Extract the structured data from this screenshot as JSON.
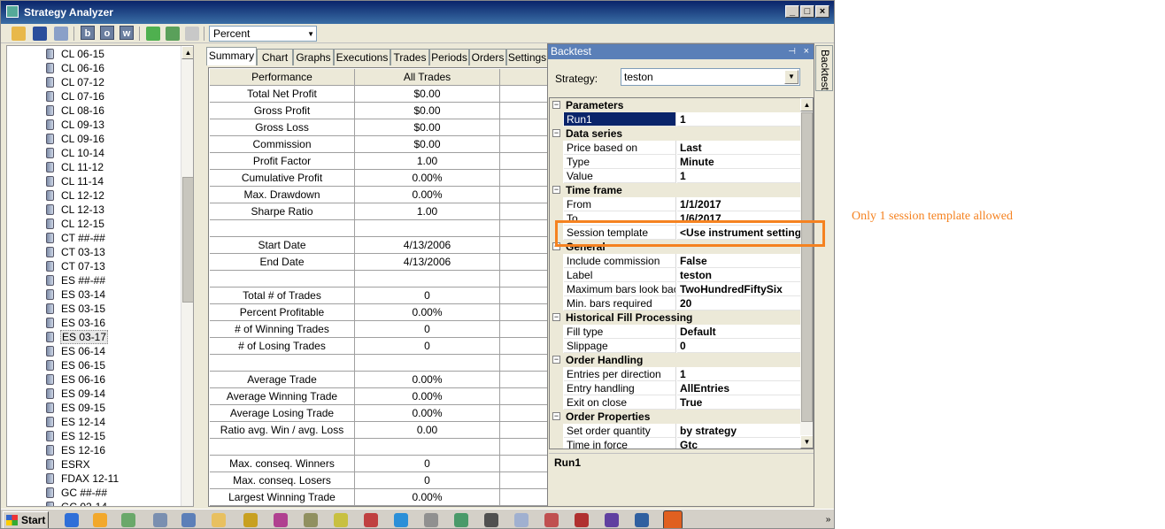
{
  "window": {
    "title": "Strategy Analyzer"
  },
  "toolbar": {
    "letter_buttons": [
      "b",
      "o",
      "w"
    ],
    "display_select": "Percent"
  },
  "instruments": [
    "CL 06-15",
    "CL 06-16",
    "CL 07-12",
    "CL 07-16",
    "CL 08-16",
    "CL 09-13",
    "CL 09-16",
    "CL 10-14",
    "CL 11-12",
    "CL 11-14",
    "CL 12-12",
    "CL 12-13",
    "CL 12-15",
    "CT ##-##",
    "CT 03-13",
    "CT 07-13",
    "ES ##-##",
    "ES 03-14",
    "ES 03-15",
    "ES 03-16",
    "ES 03-17",
    "ES 06-14",
    "ES 06-15",
    "ES 06-16",
    "ES 09-14",
    "ES 09-15",
    "ES 12-14",
    "ES 12-15",
    "ES 12-16",
    "ESRX",
    "FDAX 12-11",
    "GC ##-##",
    "GC 02-14"
  ],
  "selected_instrument": "ES 03-17",
  "tabs": [
    "Summary",
    "Chart",
    "Graphs",
    "Executions",
    "Trades",
    "Periods",
    "Orders",
    "Settings"
  ],
  "active_tab": "Summary",
  "summary": {
    "headers": [
      "Performance",
      "All Trades"
    ],
    "rows": [
      [
        "Total Net Profit",
        "$0.00"
      ],
      [
        "Gross Profit",
        "$0.00"
      ],
      [
        "Gross Loss",
        "$0.00"
      ],
      [
        "Commission",
        "$0.00"
      ],
      [
        "Profit Factor",
        "1.00"
      ],
      [
        "Cumulative Profit",
        "0.00%"
      ],
      [
        "Max. Drawdown",
        "0.00%"
      ],
      [
        "Sharpe Ratio",
        "1.00"
      ],
      [
        "",
        ""
      ],
      [
        "Start Date",
        "4/13/2006"
      ],
      [
        "End Date",
        "4/13/2006"
      ],
      [
        "",
        ""
      ],
      [
        "Total # of Trades",
        "0"
      ],
      [
        "Percent Profitable",
        "0.00%"
      ],
      [
        "# of Winning Trades",
        "0"
      ],
      [
        "# of Losing Trades",
        "0"
      ],
      [
        "",
        ""
      ],
      [
        "Average Trade",
        "0.00%"
      ],
      [
        "Average Winning Trade",
        "0.00%"
      ],
      [
        "Average Losing Trade",
        "0.00%"
      ],
      [
        "Ratio avg. Win / avg. Loss",
        "0.00"
      ],
      [
        "",
        ""
      ],
      [
        "Max. conseq. Winners",
        "0"
      ],
      [
        "Max. conseq. Losers",
        "0"
      ],
      [
        "Largest Winning Trade",
        "0.00%"
      ]
    ]
  },
  "backtest": {
    "title": "Backtest",
    "side_tab": "Backtest",
    "strategy_label": "Strategy:",
    "strategy_value": "teston",
    "properties": [
      {
        "category": "Parameters"
      },
      {
        "name": "Run1",
        "value": "1",
        "selected": true
      },
      {
        "category": "Data series"
      },
      {
        "name": "Price based on",
        "value": "Last"
      },
      {
        "name": "Type",
        "value": "Minute"
      },
      {
        "name": "Value",
        "value": "1"
      },
      {
        "category": "Time frame"
      },
      {
        "name": "From",
        "value": "1/1/2017"
      },
      {
        "name": "To",
        "value": "1/6/2017"
      },
      {
        "name": "Session template",
        "value": "<Use instrument settings"
      },
      {
        "category": "General"
      },
      {
        "name": "Include commission",
        "value": "False"
      },
      {
        "name": "Label",
        "value": "teston"
      },
      {
        "name": "Maximum bars look back",
        "value": "TwoHundredFiftySix"
      },
      {
        "name": "Min. bars required",
        "value": "20"
      },
      {
        "category": "Historical Fill Processing"
      },
      {
        "name": "Fill type",
        "value": "Default"
      },
      {
        "name": "Slippage",
        "value": "0"
      },
      {
        "category": "Order Handling"
      },
      {
        "name": "Entries per direction",
        "value": "1"
      },
      {
        "name": "Entry handling",
        "value": "AllEntries"
      },
      {
        "name": "Exit on close",
        "value": "True"
      },
      {
        "category": "Order Properties"
      },
      {
        "name": "Set order quantity",
        "value": "by strategy"
      },
      {
        "name": "Time in force",
        "value": "Gtc"
      }
    ],
    "description_title": "Run1"
  },
  "annotation": {
    "text": "Only 1 session template allowed",
    "color": "#f58220"
  },
  "taskbar": {
    "start_label": "Start"
  }
}
